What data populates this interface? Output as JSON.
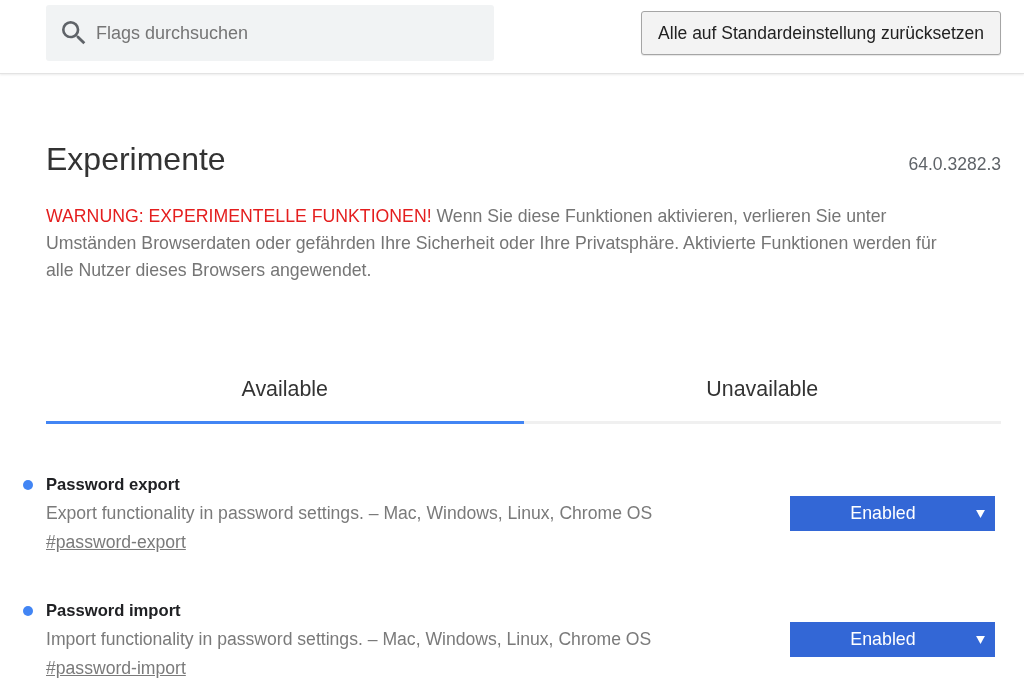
{
  "search": {
    "placeholder": "Flags durchsuchen"
  },
  "reset_button": {
    "label": "Alle auf Standardeinstellung zurücksetzen"
  },
  "title": "Experimente",
  "version": "64.0.3282.3",
  "warning": {
    "label": "WARNUNG: EXPERIMENTELLE FUNKTIONEN!",
    "text": "Wenn Sie diese Funktionen aktivieren, verlieren Sie unter Umständen Browserdaten oder gefährden Ihre Sicherheit oder Ihre Privatsphäre. Aktivierte Funktionen werden für alle Nutzer dieses Browsers angewendet."
  },
  "tabs": [
    {
      "label": "Available",
      "selected": true
    },
    {
      "label": "Unavailable",
      "selected": false
    }
  ],
  "experiments": [
    {
      "name": "Password export",
      "modified": true,
      "description": "Export functionality in password settings. – Mac, Windows, Linux, Chrome OS",
      "link": "#password-export",
      "value": "Enabled"
    },
    {
      "name": "Password import",
      "modified": true,
      "description": "Import functionality in password settings. – Mac, Windows, Linux, Chrome OS",
      "link": "#password-import",
      "value": "Enabled"
    }
  ]
}
